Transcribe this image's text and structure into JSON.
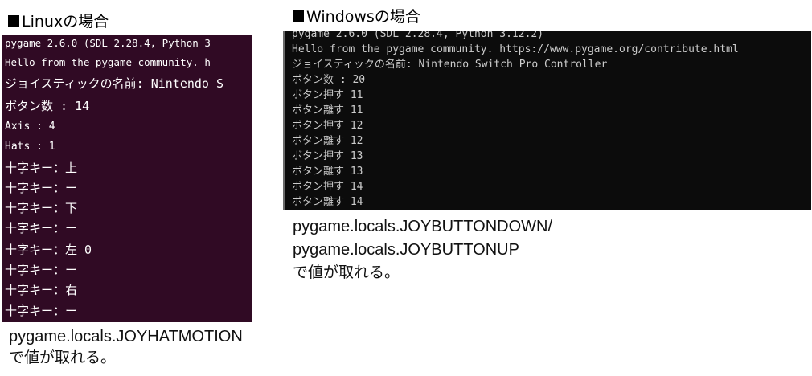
{
  "linux": {
    "heading": "Linuxの場合",
    "terminal_lines": [
      "pygame 2.6.0 (SDL 2.28.4, Python 3",
      "Hello from the pygame community. h",
      "ジョイスティックの名前: Nintendo S",
      "ボタン数 : 14",
      "Axis : 4",
      "Hats : 1",
      "十字キー：上",
      "十字キー：ー",
      "十字キー：下",
      "十字キー：ー",
      "十字キー：左 0",
      "十字キー：ー",
      "十字キー：右",
      "十字キー：ー"
    ],
    "caption_line1": "pygame.locals.JOYHATMOTION",
    "caption_line2": "で値が取れる。"
  },
  "windows": {
    "heading": "Windowsの場合",
    "terminal_lines": [
      "pygame 2.6.0 (SDL 2.28.4, Python 3.12.2)",
      "Hello from the pygame community. https://www.pygame.org/contribute.html",
      "ジョイスティックの名前: Nintendo Switch Pro Controller",
      "ボタン数 : 20",
      "ボタン押す 11",
      "ボタン離す 11",
      "ボタン押す 12",
      "ボタン離す 12",
      "ボタン押す 13",
      "ボタン離す 13",
      "ボタン押す 14",
      "ボタン離す 14"
    ],
    "caption_line1": "pygame.locals.JOYBUTTONDOWN/",
    "caption_line2": "pygame.locals.JOYBUTTONUP",
    "caption_line3": "で値が取れる。"
  },
  "colors": {
    "linux_terminal_bg": "#300a24",
    "windows_terminal_bg": "#0c0c0c"
  }
}
